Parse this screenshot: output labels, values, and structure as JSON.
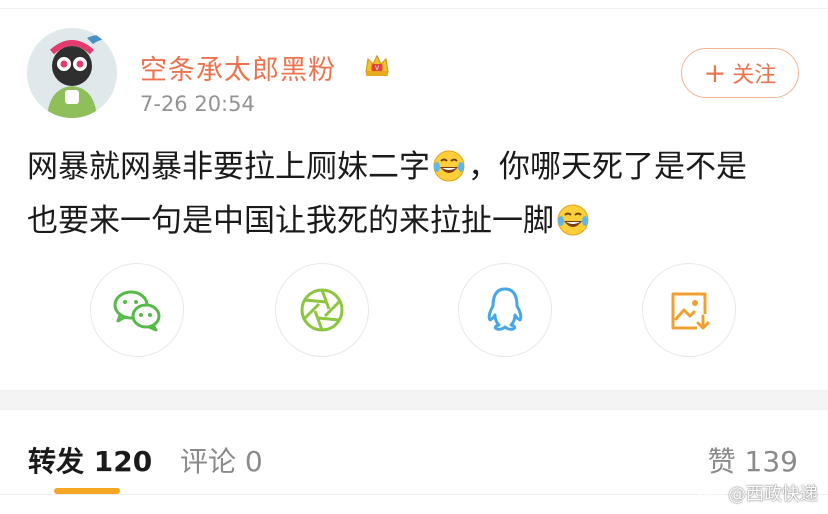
{
  "header": {
    "username": "空条承太郎黑粉",
    "timestamp": "7-26 20:54",
    "follow_label": "关注",
    "follow_plus": "+"
  },
  "post": {
    "line1_a": "网暴就网暴非要拉上厕妹二字",
    "line1_b": "，你哪天死了是不是",
    "line2": "也要来一句是中国让我死的来拉扯一脚",
    "emoji_icon": "laugh-cry-emoji"
  },
  "share": {
    "icons": [
      "wechat-icon",
      "moments-icon",
      "qq-icon",
      "save-image-icon"
    ],
    "colors": {
      "wechat": "#58b94b",
      "moments": "#8cc63f",
      "qq": "#45a7e6",
      "save": "#f0a030"
    }
  },
  "tabs": {
    "repost_label": "转发",
    "repost_count": "120",
    "comment_label": "评论",
    "comment_count": "0",
    "like_label": "赞",
    "like_count": "139"
  },
  "watermark": {
    "text": "@西政快递"
  },
  "colors": {
    "accent": "#eb7350",
    "tab_indicator": "#f5a623",
    "text": "#1a1a1a",
    "muted": "#939393"
  }
}
